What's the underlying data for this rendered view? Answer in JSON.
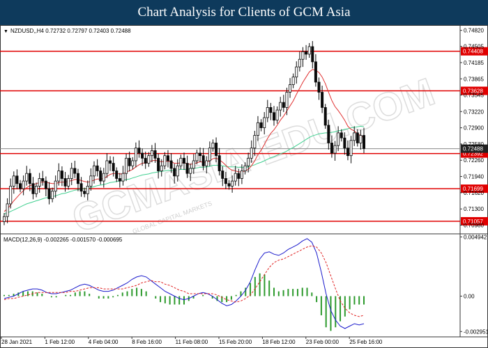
{
  "banner": {
    "title": "Chart Analysis for Clients of GCM Asia"
  },
  "watermark": {
    "text": "GCMASIA-EDU.COM",
    "subtext": "GLOBAL CAPITAL MARKETS"
  },
  "colors": {
    "candle": "#0a0a0a",
    "level_line": "#e00000",
    "ma_red": "#e03030",
    "ma_green": "#40d090",
    "current_line": "#888888",
    "macd_line": "#1a1acc",
    "signal_line": "#e02020",
    "histogram": "#2c9a2c",
    "banner_bg": "#0e3a5c"
  },
  "chart_data": [
    {
      "type": "candlestick",
      "symbol_header": "NZDUSD,,H4  0.72732 0.72797 0.72403 0.72488",
      "ylim": [
        0.7085,
        0.7487
      ],
      "y_ticks": [
        {
          "value": 0.7482,
          "label": "0.74820"
        },
        {
          "value": 0.74505,
          "label": "0.74505"
        },
        {
          "value": 0.74185,
          "label": "0.74185"
        },
        {
          "value": 0.73865,
          "label": "0.73865"
        },
        {
          "value": 0.73545,
          "label": "0.73545"
        },
        {
          "value": 0.7322,
          "label": "0.73220"
        },
        {
          "value": 0.729,
          "label": "0.72900"
        },
        {
          "value": 0.7258,
          "label": "0.72580"
        },
        {
          "value": 0.7226,
          "label": "0.72260"
        },
        {
          "value": 0.7194,
          "label": "0.71940"
        },
        {
          "value": 0.7162,
          "label": "0.71620"
        },
        {
          "value": 0.713,
          "label": "0.71300"
        },
        {
          "value": 0.7098,
          "label": "0.70980"
        }
      ],
      "levels": [
        {
          "value": 0.74408,
          "label": "0.74408"
        },
        {
          "value": 0.73628,
          "label": "0.73628"
        },
        {
          "value": 0.72392,
          "label": "0.72392"
        },
        {
          "value": 0.71699,
          "label": "0.71699"
        },
        {
          "value": 0.71057,
          "label": "0.71057"
        }
      ],
      "current_price": {
        "value": 0.72488,
        "label": "0.72488"
      },
      "x_labels": [
        "28 Jan 2021",
        "1 Feb 12:00",
        "4 Feb 04:00",
        "8 Feb 16:00",
        "11 Feb 08:00",
        "15 Feb 20:00",
        "18 Feb 12:00",
        "23 Feb 00:00",
        "25 Feb 16:00"
      ],
      "closes": [
        0.7115,
        0.714,
        0.7175,
        0.7195,
        0.718,
        0.717,
        0.7185,
        0.72,
        0.718,
        0.716,
        0.7175,
        0.719,
        0.7185,
        0.717,
        0.715,
        0.7165,
        0.7185,
        0.7205,
        0.719,
        0.7175,
        0.719,
        0.721,
        0.72,
        0.718,
        0.7165,
        0.716,
        0.7175,
        0.7195,
        0.7215,
        0.7205,
        0.7185,
        0.72,
        0.7225,
        0.722,
        0.7205,
        0.719,
        0.7185,
        0.72,
        0.723,
        0.7215,
        0.7225,
        0.725,
        0.724,
        0.723,
        0.722,
        0.7235,
        0.7245,
        0.723,
        0.7205,
        0.7215,
        0.7235,
        0.7225,
        0.721,
        0.7195,
        0.7215,
        0.723,
        0.722,
        0.72,
        0.721,
        0.7225,
        0.724,
        0.7235,
        0.7215,
        0.7225,
        0.725,
        0.726,
        0.7235,
        0.7205,
        0.719,
        0.718,
        0.7175,
        0.7185,
        0.72,
        0.719,
        0.7205,
        0.7215,
        0.723,
        0.725,
        0.7275,
        0.73,
        0.729,
        0.731,
        0.733,
        0.732,
        0.7305,
        0.7325,
        0.734,
        0.733,
        0.736,
        0.7375,
        0.739,
        0.741,
        0.7425,
        0.744,
        0.7435,
        0.745,
        0.742,
        0.738,
        0.736,
        0.733,
        0.7295,
        0.726,
        0.724,
        0.7255,
        0.728,
        0.727,
        0.725,
        0.7235,
        0.7265,
        0.728,
        0.726,
        0.7275,
        0.7249
      ],
      "ma_red": [
        0.7125,
        0.713,
        0.7138,
        0.7146,
        0.7153,
        0.716,
        0.7166,
        0.7172,
        0.7176,
        0.7178,
        0.718,
        0.7182,
        0.7183,
        0.7183,
        0.7181,
        0.718,
        0.718,
        0.7182,
        0.7183,
        0.7183,
        0.7184,
        0.7186,
        0.7188,
        0.7188,
        0.7186,
        0.7184,
        0.7183,
        0.7184,
        0.7187,
        0.7189,
        0.7189,
        0.719,
        0.7194,
        0.7198,
        0.72,
        0.72,
        0.7199,
        0.7199,
        0.7203,
        0.7205,
        0.7208,
        0.7213,
        0.7217,
        0.722,
        0.7221,
        0.7223,
        0.7225,
        0.7226,
        0.7224,
        0.7223,
        0.7224,
        0.7224,
        0.7223,
        0.722,
        0.722,
        0.7221,
        0.7221,
        0.7219,
        0.7218,
        0.7219,
        0.7221,
        0.7223,
        0.7222,
        0.7222,
        0.7225,
        0.7229,
        0.723,
        0.7227,
        0.7222,
        0.7216,
        0.721,
        0.7206,
        0.7205,
        0.7203,
        0.7203,
        0.7205,
        0.7208,
        0.7215,
        0.7225,
        0.7237,
        0.7246,
        0.7257,
        0.7269,
        0.7279,
        0.7286,
        0.7295,
        0.7305,
        0.7313,
        0.7323,
        0.7333,
        0.7343,
        0.7356,
        0.7368,
        0.738,
        0.739,
        0.74,
        0.7405,
        0.7403,
        0.7399,
        0.739,
        0.7377,
        0.736,
        0.7344,
        0.7332,
        0.7324,
        0.7315,
        0.7305,
        0.7293,
        0.7287,
        0.7284,
        0.7278,
        0.7275,
        0.727
      ],
      "ma_green": [
        0.712,
        0.7122,
        0.7125,
        0.7128,
        0.7131,
        0.7134,
        0.7137,
        0.714,
        0.7142,
        0.7144,
        0.7146,
        0.7148,
        0.715,
        0.7152,
        0.7153,
        0.7154,
        0.7156,
        0.7158,
        0.716,
        0.7161,
        0.7163,
        0.7165,
        0.7167,
        0.7168,
        0.7169,
        0.717,
        0.7171,
        0.7172,
        0.7174,
        0.7176,
        0.7177,
        0.7178,
        0.718,
        0.7182,
        0.7183,
        0.7184,
        0.7185,
        0.7186,
        0.7188,
        0.7189,
        0.7191,
        0.7193,
        0.7195,
        0.7197,
        0.7198,
        0.7199,
        0.7201,
        0.7202,
        0.7203,
        0.7204,
        0.7205,
        0.7206,
        0.7206,
        0.7206,
        0.7207,
        0.7208,
        0.7208,
        0.7208,
        0.7209,
        0.721,
        0.7211,
        0.7212,
        0.7212,
        0.7213,
        0.7214,
        0.7216,
        0.7216,
        0.7216,
        0.7215,
        0.7214,
        0.7213,
        0.7213,
        0.7213,
        0.7212,
        0.7212,
        0.7212,
        0.7213,
        0.7215,
        0.7217,
        0.722,
        0.7222,
        0.7225,
        0.7228,
        0.7231,
        0.7233,
        0.7236,
        0.7239,
        0.7241,
        0.7244,
        0.7248,
        0.7251,
        0.7255,
        0.7259,
        0.7263,
        0.7267,
        0.7271,
        0.7274,
        0.7276,
        0.7278,
        0.7279,
        0.728,
        0.728,
        0.7281,
        0.7282,
        0.7284,
        0.7285,
        0.7287,
        0.7288,
        0.729,
        0.7291,
        0.7292,
        0.7293,
        0.7292
      ]
    },
    {
      "type": "line",
      "title": "MACD(12,26,9) -0.002265 -0.001570 -0.000695",
      "ylim": [
        -0.00305,
        0.00508
      ],
      "y_ticks": [
        {
          "value": 0.004942,
          "label": "0.004942"
        },
        {
          "value": 0.0,
          "label": "0.00"
        },
        {
          "value": -0.002951,
          "label": "-0.002951"
        }
      ],
      "series": [
        {
          "values": [
            -0.0002,
            -0.0001,
            0.0,
            0.0002,
            0.0004,
            0.0005,
            0.0006,
            0.0006,
            0.0005,
            0.0003,
            0.0002,
            0.0002,
            0.0003,
            0.0004,
            0.0005,
            0.0007,
            0.0009,
            0.001,
            0.0009,
            0.0007,
            0.0005,
            0.0004,
            0.0004,
            0.0005,
            0.0007,
            0.0009,
            0.0011,
            0.0014,
            0.0016,
            0.0017,
            0.0016,
            0.0013,
            0.001,
            0.0007,
            0.0004,
            0.0002,
            0.0,
            -0.0002,
            -0.0003,
            -0.0002,
            0.0,
            0.0002,
            0.0003,
            0.0002,
            0.0,
            -0.0003,
            -0.0006,
            -0.0008,
            -0.0007,
            -0.0004,
            0.0,
            0.0005,
            0.0012,
            0.0022,
            0.0031,
            0.0036,
            0.0037,
            0.0035,
            0.0034,
            0.0036,
            0.0039,
            0.0041,
            0.0043,
            0.0046,
            0.0048,
            0.0045,
            0.0036,
            0.002,
            0.0002,
            -0.0012,
            -0.002,
            -0.0025,
            -0.0027,
            -0.0025,
            -0.0023,
            -0.0024,
            -0.0023
          ]
        },
        {
          "values": [
            -0.0003,
            -0.0002,
            -0.0002,
            -0.0001,
            0.0,
            0.0001,
            0.0002,
            0.0003,
            0.0003,
            0.0003,
            0.0003,
            0.0003,
            0.0003,
            0.0003,
            0.0004,
            0.0004,
            0.0005,
            0.0006,
            0.0007,
            0.0007,
            0.0007,
            0.0006,
            0.0006,
            0.0006,
            0.0006,
            0.0006,
            0.0007,
            0.0008,
            0.0009,
            0.0011,
            0.0012,
            0.0013,
            0.0012,
            0.0012,
            0.001,
            0.0009,
            0.0007,
            0.0005,
            0.0004,
            0.0002,
            0.0002,
            0.0002,
            0.0002,
            0.0002,
            0.0002,
            0.0001,
            -0.0001,
            -0.0003,
            -0.0004,
            -0.0005,
            -0.0004,
            -0.0002,
            0.0001,
            0.0006,
            0.0012,
            0.0018,
            0.0024,
            0.0028,
            0.003,
            0.0031,
            0.0033,
            0.0035,
            0.0037,
            0.0039,
            0.0041,
            0.0042,
            0.0041,
            0.0036,
            0.0028,
            0.0017,
            0.0006,
            -0.0004,
            -0.001,
            -0.0014,
            -0.0016,
            -0.0017,
            -0.0016
          ]
        },
        {
          "values": [
            0.0001,
            0.0001,
            0.0002,
            0.0003,
            0.0004,
            0.0004,
            0.0004,
            0.0003,
            0.0002,
            0.0,
            -0.0001,
            -0.0001,
            0.0,
            0.0001,
            0.0001,
            0.0003,
            0.0004,
            0.0004,
            0.0002,
            0.0,
            -0.0002,
            -0.0002,
            -0.0002,
            -0.0001,
            0.0001,
            0.0003,
            0.0004,
            0.0006,
            0.0007,
            0.0006,
            0.0004,
            0.0,
            -0.0002,
            -0.0005,
            -0.0006,
            -0.0007,
            -0.0007,
            -0.0007,
            -0.0007,
            -0.0004,
            -0.0002,
            0.0,
            0.0001,
            0.0,
            -0.0002,
            -0.0004,
            -0.0005,
            -0.0005,
            -0.0003,
            0.0001,
            0.0004,
            0.0007,
            0.0011,
            0.0016,
            0.0019,
            0.0018,
            0.0013,
            0.0007,
            0.0004,
            0.0005,
            0.0006,
            0.0006,
            0.0006,
            0.0007,
            0.0007,
            0.0003,
            -0.0005,
            -0.0016,
            -0.0026,
            -0.0029,
            -0.0026,
            -0.0021,
            -0.0017,
            -0.0011,
            -0.0007,
            -0.0007,
            -0.0007
          ]
        }
      ]
    }
  ]
}
